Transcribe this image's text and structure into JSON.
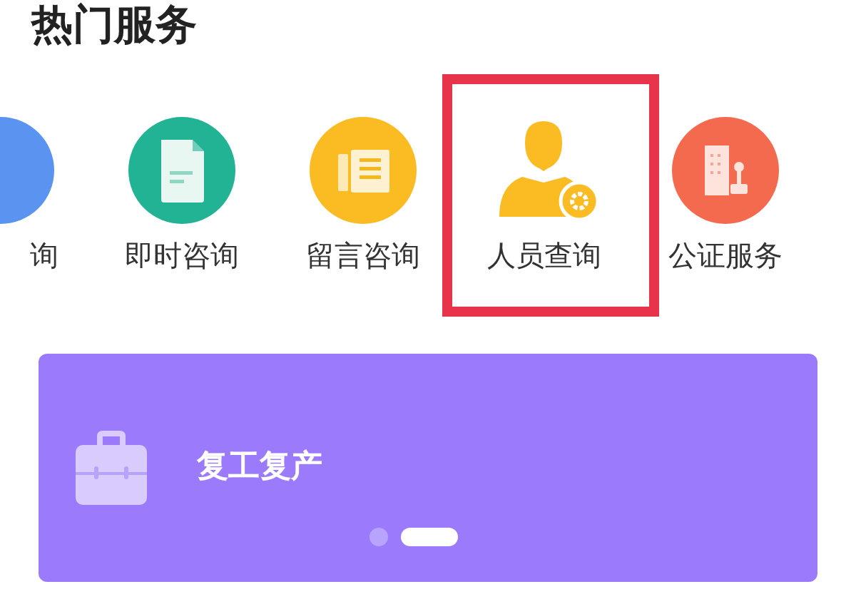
{
  "section_title": "热门服务",
  "services": [
    {
      "label": "询",
      "kind": "partial",
      "highlighted": false
    },
    {
      "label": "即时咨询",
      "kind": "full",
      "highlighted": false
    },
    {
      "label": "留言咨询",
      "kind": "full",
      "highlighted": false
    },
    {
      "label": "人员查询",
      "kind": "full",
      "highlighted": true
    },
    {
      "label": "公证服务",
      "kind": "full",
      "highlighted": false
    }
  ],
  "banner": {
    "title": "复工复产",
    "dots": [
      {
        "selected": false
      },
      {
        "selected": true
      }
    ]
  }
}
